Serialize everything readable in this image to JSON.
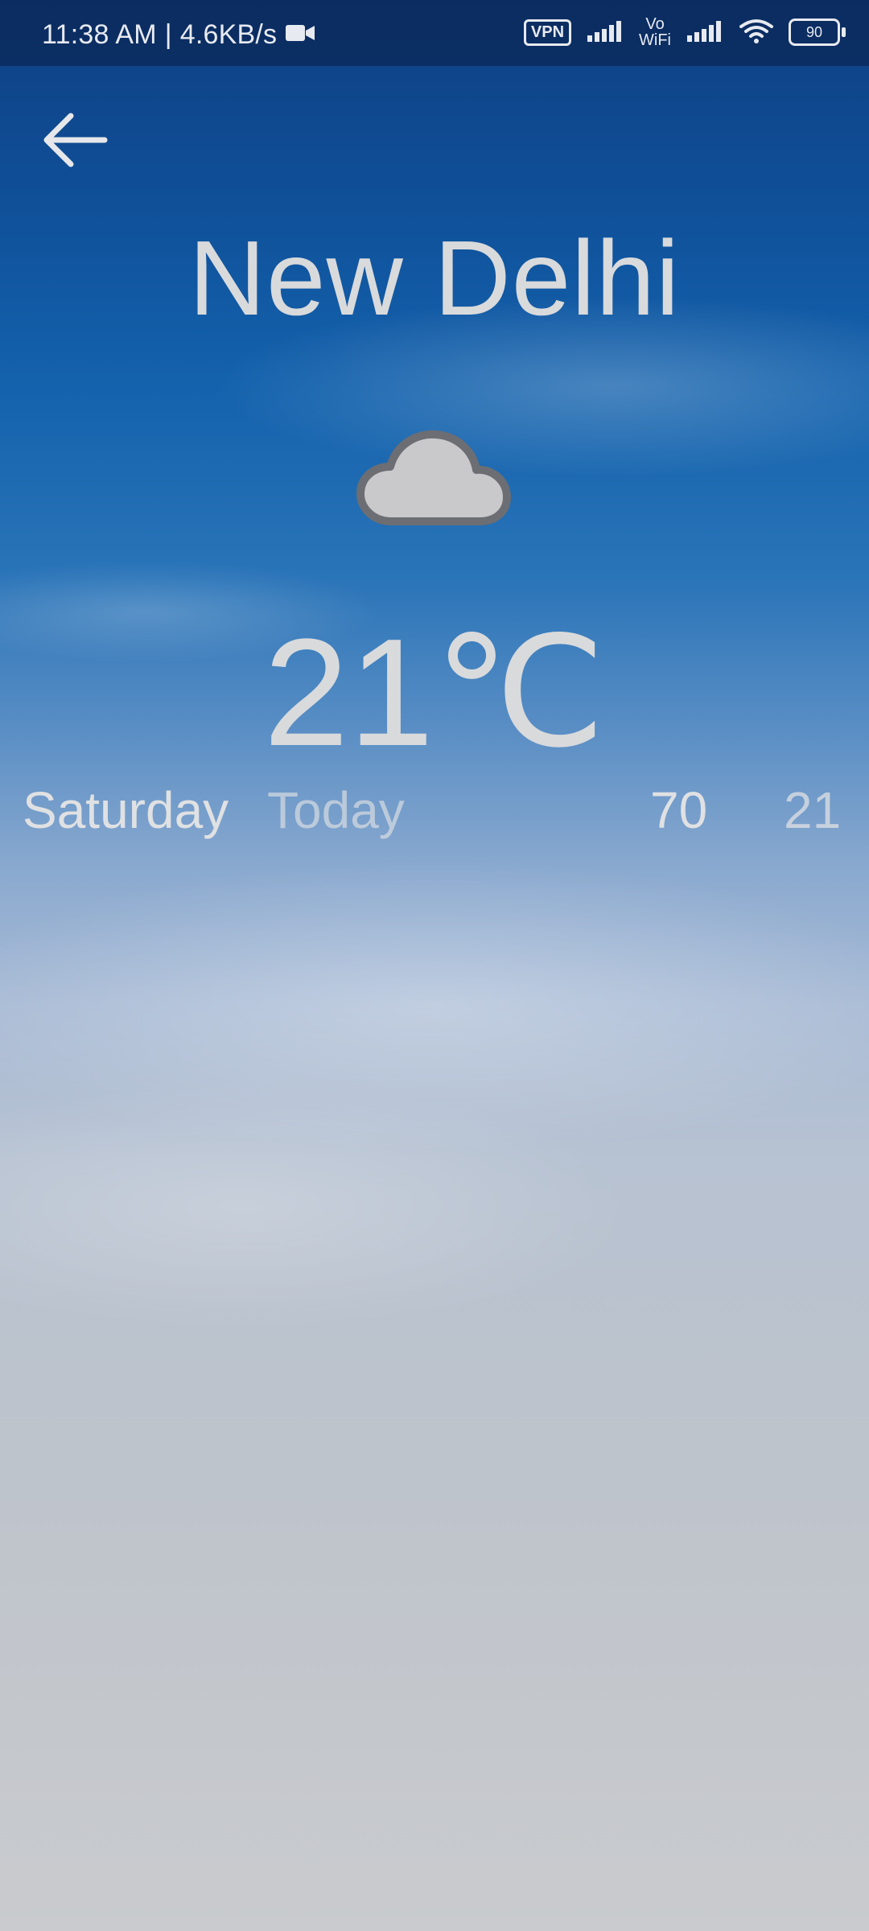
{
  "status_bar": {
    "time": "11:38 AM",
    "separator": "|",
    "speed": "4.6KB/s",
    "vpn_label": "VPN",
    "vowifi_top": "Vo",
    "vowifi_bottom": "WiFi",
    "battery_level": "90"
  },
  "header": {
    "city": "New Delhi"
  },
  "weather": {
    "condition_icon": "cloud-icon",
    "temperature": "21℃"
  },
  "forecast_row": {
    "day": "Saturday",
    "label": "Today",
    "humidity": "70",
    "temperature": "21"
  },
  "colors": {
    "sky_top": "#0f3f82",
    "sky_bottom": "#c9cbce",
    "text": "#d9dadc"
  }
}
